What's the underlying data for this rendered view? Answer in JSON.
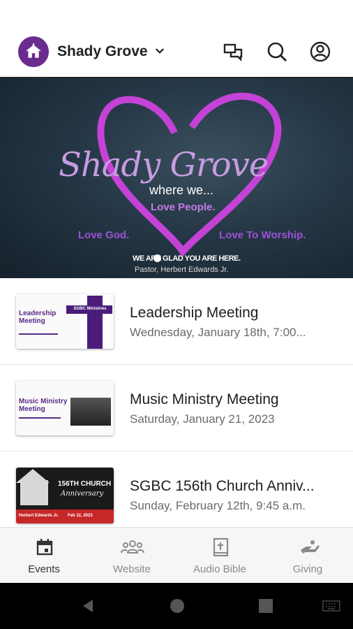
{
  "header": {
    "church_name": "Shady Grove",
    "icons": [
      "home-icon",
      "chevron-down-icon",
      "chat-icon",
      "search-icon",
      "account-icon"
    ]
  },
  "hero": {
    "title": "Shady Grove",
    "where": "where we...",
    "love_people": "Love People.",
    "love_god": "Love God.",
    "love_worship": "Love To Worship.",
    "glad": "WE ARE GLAD YOU ARE HERE.",
    "pastor": "Pastor, Herbert Edwards Jr."
  },
  "events": [
    {
      "title": "Leadership Meeting",
      "date": "Wednesday, January 18th, 7:00...",
      "thumb_title": "Leadership Meeting",
      "thumb_badge": "SGBC Ministries"
    },
    {
      "title": "Music Ministry Meeting",
      "date": "Saturday, January 21, 2023",
      "thumb_title": "Music Ministry Meeting"
    },
    {
      "title": "SGBC 156th Church Anniv...",
      "date": "Sunday, February 12th, 9:45 a.m.",
      "thumb_title": "156TH CHURCH",
      "thumb_sub": "Anniversary",
      "thumb_date": "Feb 12, 2023",
      "thumb_names": "Herbert Edwards Jr."
    }
  ],
  "bottom_nav": [
    {
      "label": "Events",
      "icon": "calendar-icon",
      "active": true
    },
    {
      "label": "Website",
      "icon": "group-icon"
    },
    {
      "label": "Audio Bible",
      "icon": "bible-icon"
    },
    {
      "label": "Giving",
      "icon": "giving-hand-icon"
    }
  ],
  "colors": {
    "brand": "#6b2c8f",
    "heart": "#c443d6",
    "nav_bg": "#f6f6f6"
  }
}
